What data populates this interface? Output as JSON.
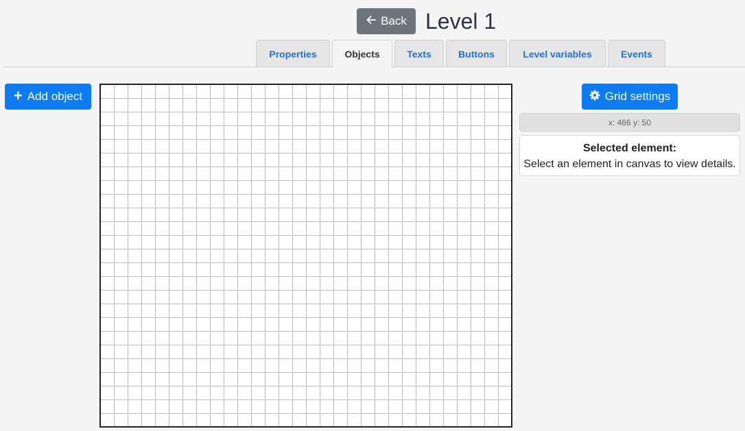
{
  "header": {
    "back_label": "Back",
    "title": "Level 1"
  },
  "tabs": [
    {
      "label": "Properties",
      "active": false
    },
    {
      "label": "Objects",
      "active": true
    },
    {
      "label": "Texts",
      "active": false
    },
    {
      "label": "Buttons",
      "active": false
    },
    {
      "label": "Level variables",
      "active": false
    },
    {
      "label": "Events",
      "active": false
    }
  ],
  "left_panel": {
    "add_label": "Add object"
  },
  "right_panel": {
    "grid_settings_label": "Grid settings",
    "coords": "x: 466 y: 50",
    "selected_title": "Selected element:",
    "selected_text": "Select an element in canvas to view details."
  },
  "colors": {
    "primary": "#0d7cf2",
    "secondary": "#6c757d",
    "tab_text": "#1a73d9"
  },
  "icons": {
    "back": "arrow-left-icon",
    "add": "plus-icon",
    "grid_settings": "gear-icon"
  }
}
